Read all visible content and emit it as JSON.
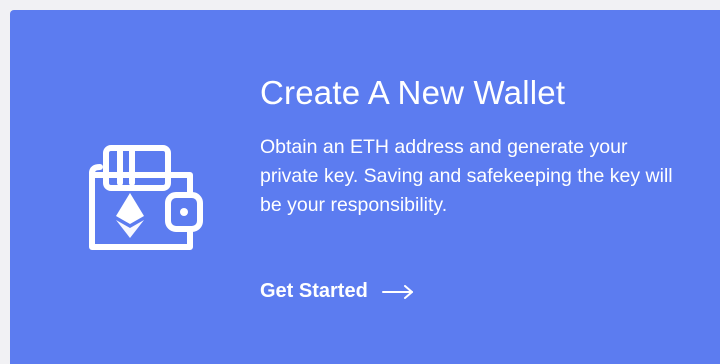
{
  "card": {
    "title": "Create A New Wallet",
    "description": "Obtain an ETH address and generate your private key. Saving and safekeeping the key will be your responsibility.",
    "cta_label": "Get Started",
    "icons": {
      "wallet": "wallet-icon",
      "ethereum": "ethereum-icon",
      "arrow": "arrow-right-icon"
    },
    "colors": {
      "background": "#5c7cf0",
      "text": "#ffffff"
    }
  }
}
